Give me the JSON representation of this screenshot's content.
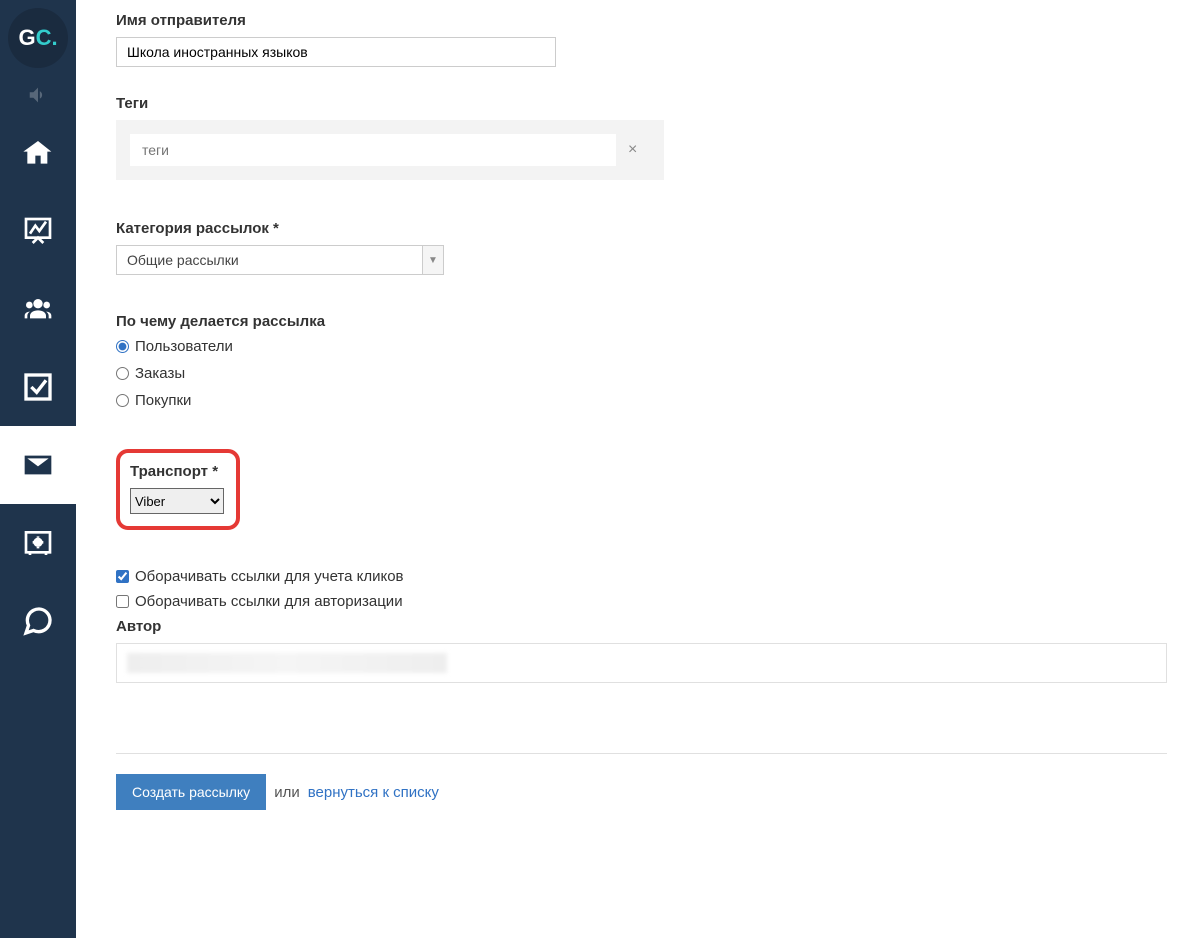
{
  "logo": {
    "g": "G",
    "c": "C."
  },
  "sender": {
    "label": "Имя отправителя",
    "value": "Школа иностранных языков"
  },
  "tags": {
    "label": "Теги",
    "placeholder": "теги",
    "clear": "×"
  },
  "category": {
    "label": "Категория рассылок *",
    "selected": "Общие рассылки"
  },
  "basis": {
    "label": "По чему делается рассылка",
    "options": {
      "users": "Пользователи",
      "orders": "Заказы",
      "purchases": "Покупки"
    }
  },
  "transport": {
    "label": "Транспорт *",
    "selected": "Viber",
    "options": [
      "Viber"
    ]
  },
  "checkboxes": {
    "wrap_clicks": "Оборачивать ссылки для учета кликов",
    "wrap_auth": "Оборачивать ссылки для авторизации"
  },
  "author": {
    "label": "Автор"
  },
  "actions": {
    "create": "Создать рассылку",
    "or": "или",
    "back": "вернуться к списку"
  }
}
